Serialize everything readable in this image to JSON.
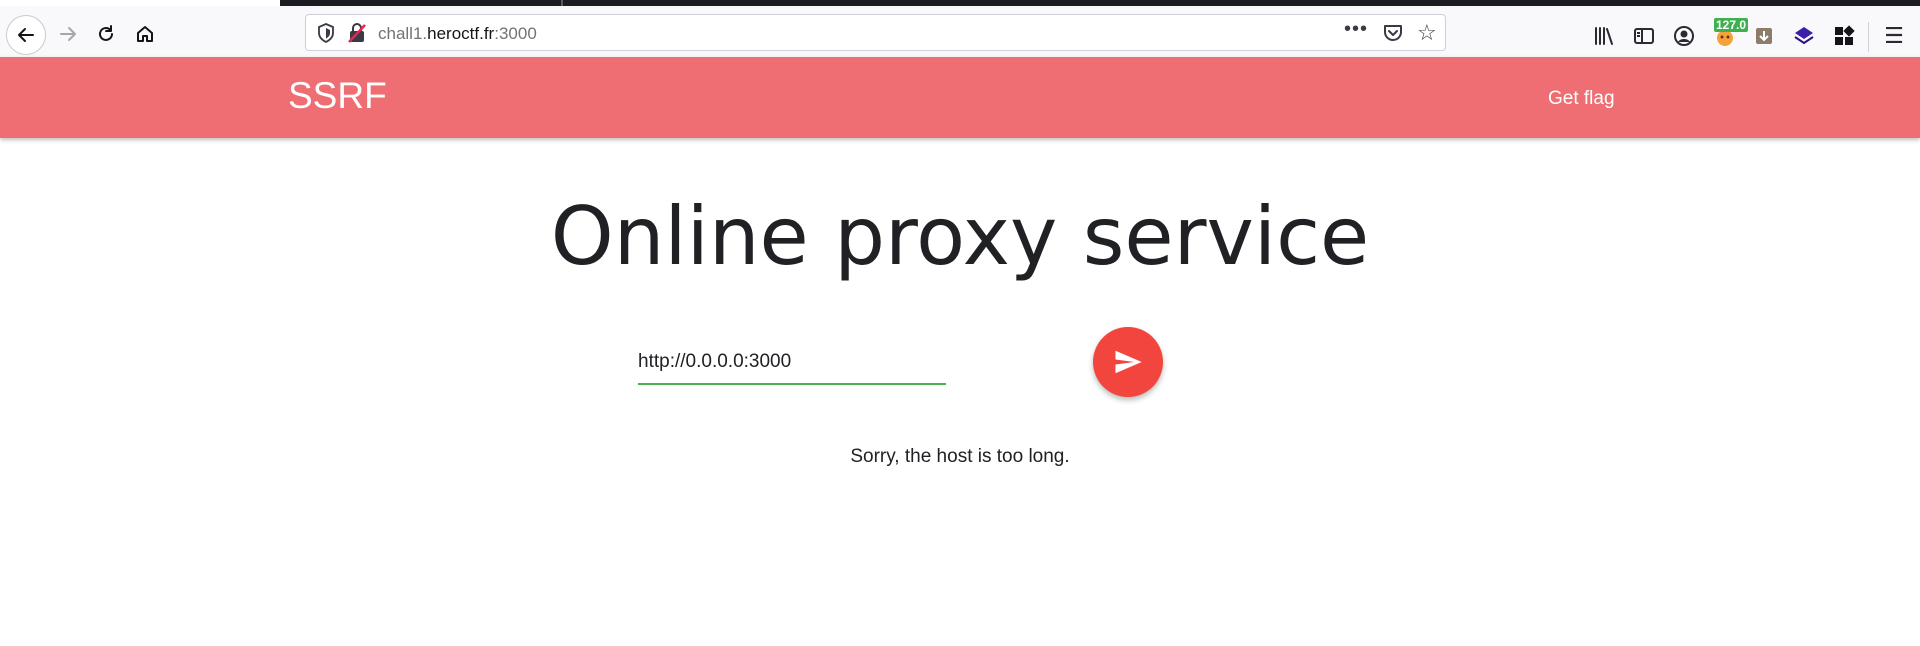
{
  "browser": {
    "url_prefix": "chall1.",
    "url_host": "heroctf.fr",
    "url_suffix": ":3000",
    "extension_badge": "127.0",
    "icons": {
      "back": "arrow-left-icon",
      "forward": "arrow-right-icon",
      "reload": "reload-icon",
      "home": "home-icon",
      "more": "more-horizontal-icon",
      "pocket": "pocket-icon",
      "bookmark": "star-icon",
      "library": "library-icon",
      "sidebar": "sidebar-icon",
      "account": "account-icon",
      "menu": "hamburger-menu-icon"
    }
  },
  "site": {
    "brand": "SSRF",
    "nav_link": "Get flag",
    "accent_color": "#ef6e73"
  },
  "main": {
    "title": "Online proxy service",
    "url_input_value": "http://0.0.0.0:3000",
    "send_button_icon": "send-icon",
    "send_button_color": "#f1453d",
    "message": "Sorry, the host is too long."
  }
}
